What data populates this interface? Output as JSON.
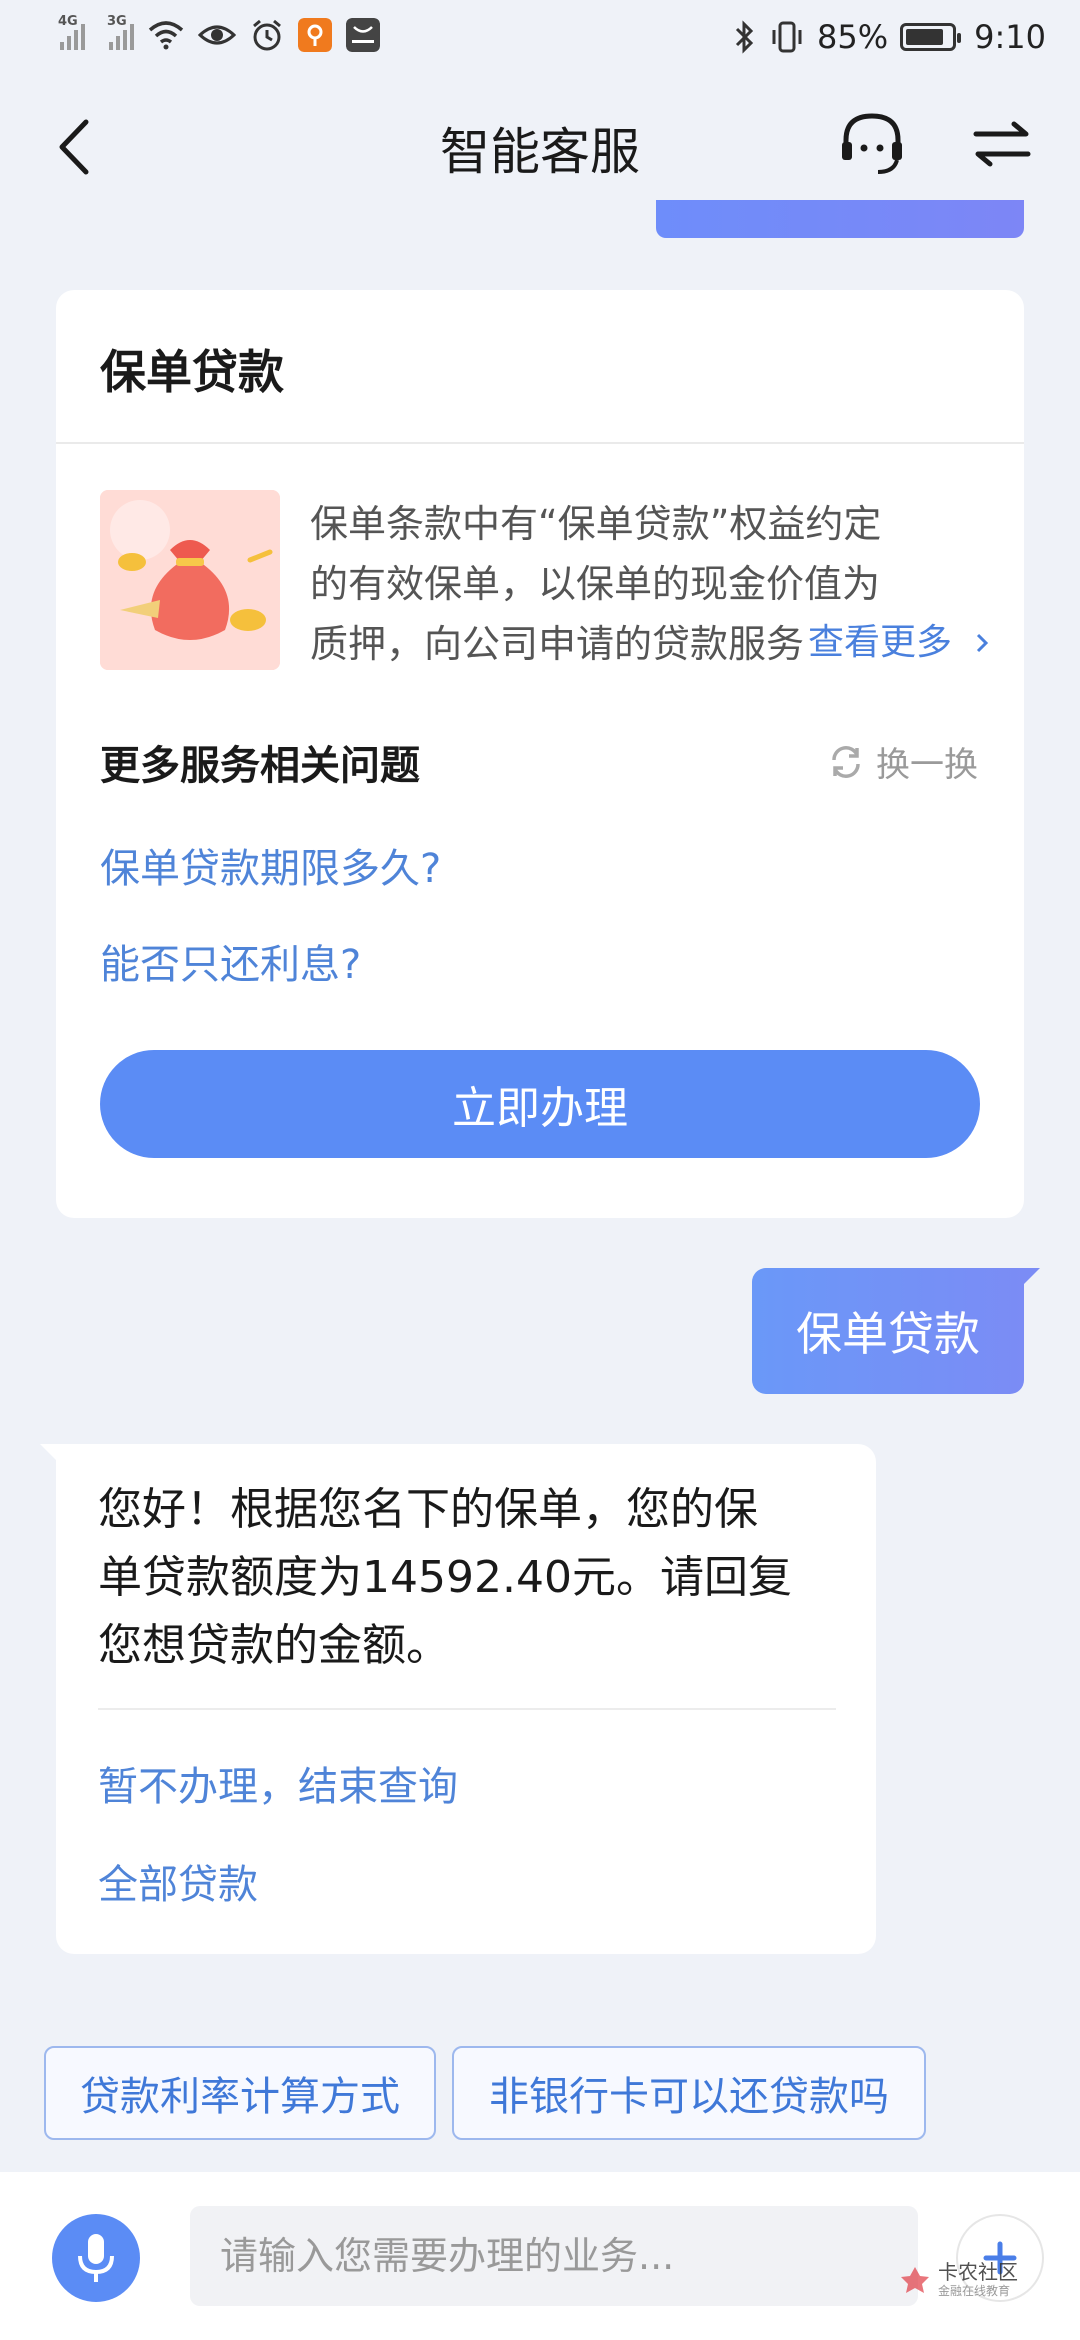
{
  "status_bar": {
    "signal1_label": "4G",
    "signal2_label": "3G",
    "battery": "85%",
    "battery_level": 0.85,
    "time": "9:10"
  },
  "header": {
    "title": "智能客服"
  },
  "card": {
    "title": "保单贷款",
    "description_lines": [
      "保单条款中有“保单贷款”权益约定",
      "的有效保单，以保单的现金价值为",
      "质押，向公司申请的贷款服务"
    ],
    "more_link": "查看更多",
    "section_title": "更多服务相关问题",
    "refresh_label": "换一换",
    "questions": [
      "保单贷款期限多久?",
      "能否只还利息?"
    ],
    "action_button": "立即办理"
  },
  "chat": {
    "user_message": "保单贷款",
    "bot_message_lines": [
      "您好！根据您名下的保单，您的保",
      "单贷款额度为14592.40元。请回复",
      "您想贷款的金额。"
    ],
    "bot_options": [
      "暂不办理，结束查询",
      "全部贷款"
    ]
  },
  "quick_replies": [
    "贷款利率计算方式",
    "非银行卡可以还贷款吗"
  ],
  "input": {
    "placeholder": "请输入您需要办理的业务..."
  },
  "watermark": {
    "main": "卡农社区",
    "sub": "金融在线教育"
  },
  "colors": {
    "accent": "#5b8cf5",
    "link": "#4f84d8",
    "background": "#eff2f8"
  },
  "icons": [
    "back-arrow-icon",
    "headset-icon",
    "swap-arrows-icon",
    "refresh-icon",
    "microphone-icon",
    "plus-icon",
    "chevron-right-icon",
    "money-bag-icon"
  ]
}
